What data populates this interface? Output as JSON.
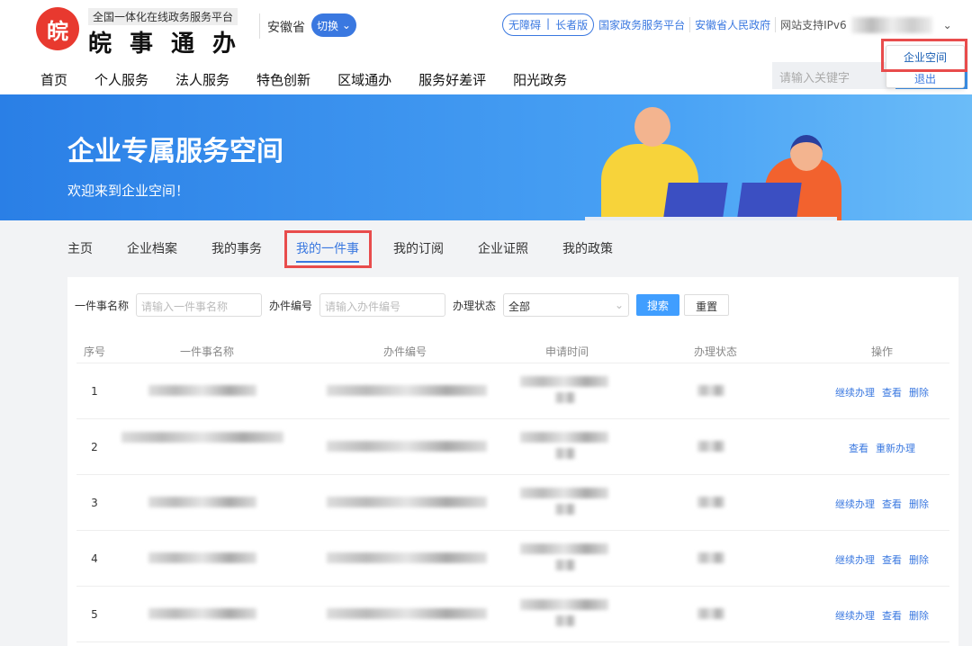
{
  "header": {
    "logo_text": "皖",
    "slogan": "全国一体化在线政务服务平台",
    "brand": "皖事通办",
    "province": "安徽省",
    "switch_label": "切换",
    "accessibility": "无障碍",
    "elder": "长者版",
    "links": [
      "国家政务服务平台",
      "安徽省人民政府"
    ],
    "ipv6": "网站支持IPv6",
    "nav": [
      "首页",
      "个人服务",
      "法人服务",
      "特色创新",
      "区域通办",
      "服务好差评",
      "阳光政务"
    ],
    "search_placeholder": "请输入关键字",
    "dropdown": [
      "企业空间",
      "退出"
    ]
  },
  "banner": {
    "title": "企业专属服务空间",
    "subtitle": "欢迎来到企业空间！"
  },
  "tabs": [
    {
      "label": "主页"
    },
    {
      "label": "企业档案"
    },
    {
      "label": "我的事务"
    },
    {
      "label": "我的一件事",
      "active": true
    },
    {
      "label": "我的订阅"
    },
    {
      "label": "企业证照"
    },
    {
      "label": "我的政策"
    }
  ],
  "filters": {
    "name_label": "一件事名称",
    "name_placeholder": "请输入一件事名称",
    "code_label": "办件编号",
    "code_placeholder": "请输入办件编号",
    "status_label": "办理状态",
    "status_value": "全部",
    "search": "搜索",
    "reset": "重置"
  },
  "table": {
    "columns": [
      "序号",
      "一件事名称",
      "办件编号",
      "申请时间",
      "办理状态",
      "操作"
    ],
    "rows": [
      {
        "no": "1",
        "actions": [
          "继续办理",
          "查看",
          "删除"
        ]
      },
      {
        "no": "2",
        "actions": [
          "查看",
          "重新办理"
        ]
      },
      {
        "no": "3",
        "actions": [
          "继续办理",
          "查看",
          "删除"
        ]
      },
      {
        "no": "4",
        "actions": [
          "继续办理",
          "查看",
          "删除"
        ]
      },
      {
        "no": "5",
        "actions": [
          "继续办理",
          "查看",
          "删除"
        ]
      }
    ]
  }
}
